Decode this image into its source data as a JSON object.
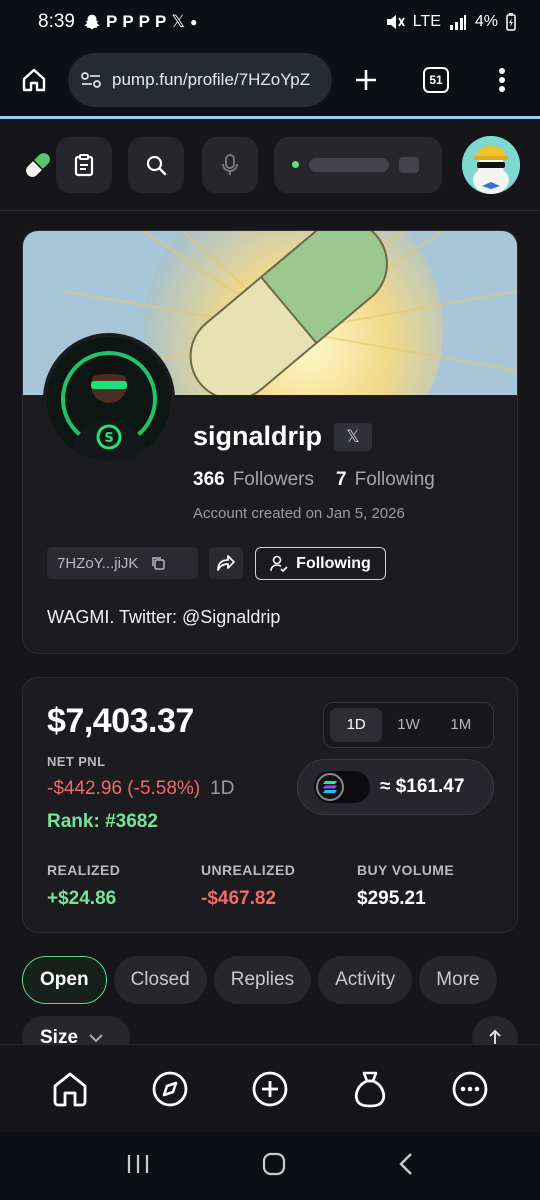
{
  "status_bar": {
    "time": "8:39",
    "notif_icons": [
      "snapchat-icon",
      "p-icon",
      "p-icon",
      "p-icon",
      "p-icon",
      "x-icon",
      "dot-icon"
    ],
    "network": "LTE",
    "battery": "4%"
  },
  "browser": {
    "url": "pump.fun/profile/7HZoYpZ",
    "tab_count": "51"
  },
  "header": {
    "icons": [
      "pill-logo-icon",
      "clipboard-icon",
      "search-icon",
      "microphone-icon"
    ]
  },
  "profile": {
    "username": "signaldrip",
    "x_badge": "𝕏",
    "followers_count": "366",
    "followers_label": "Followers",
    "following_count": "7",
    "following_label": "Following",
    "created": "Account created on Jan 5, 2026",
    "address": "7HZoY...jiJK",
    "follow_button": "Following",
    "bio": "WAGMI. Twitter: @Signaldrip"
  },
  "pnl": {
    "balance": "$7,403.37",
    "net_pnl_label": "NET PNL",
    "net_pnl_value": "-$442.96 (-5.58%)",
    "net_pnl_period": "1D",
    "rank": "Rank: #3682",
    "periods": [
      "1D",
      "1W",
      "1M"
    ],
    "active_period": "1D",
    "sol_value": "≈ $161.47",
    "realized_label": "REALIZED",
    "realized_value": "+$24.86",
    "unrealized_label": "UNREALIZED",
    "unrealized_value": "-$467.82",
    "buy_volume_label": "BUY VOLUME",
    "buy_volume_value": "$295.21",
    "colors": {
      "positive": "#76e39a",
      "negative": "#f06a6a"
    }
  },
  "tabs": [
    {
      "label": "Open"
    },
    {
      "label": "Closed"
    },
    {
      "label": "Replies"
    },
    {
      "label": "Activity"
    },
    {
      "label": "More"
    }
  ],
  "filter": {
    "size_label": "Size"
  },
  "bottom_nav": [
    "home-icon",
    "compass-icon",
    "create-icon",
    "money-bag-icon",
    "more-icon"
  ]
}
